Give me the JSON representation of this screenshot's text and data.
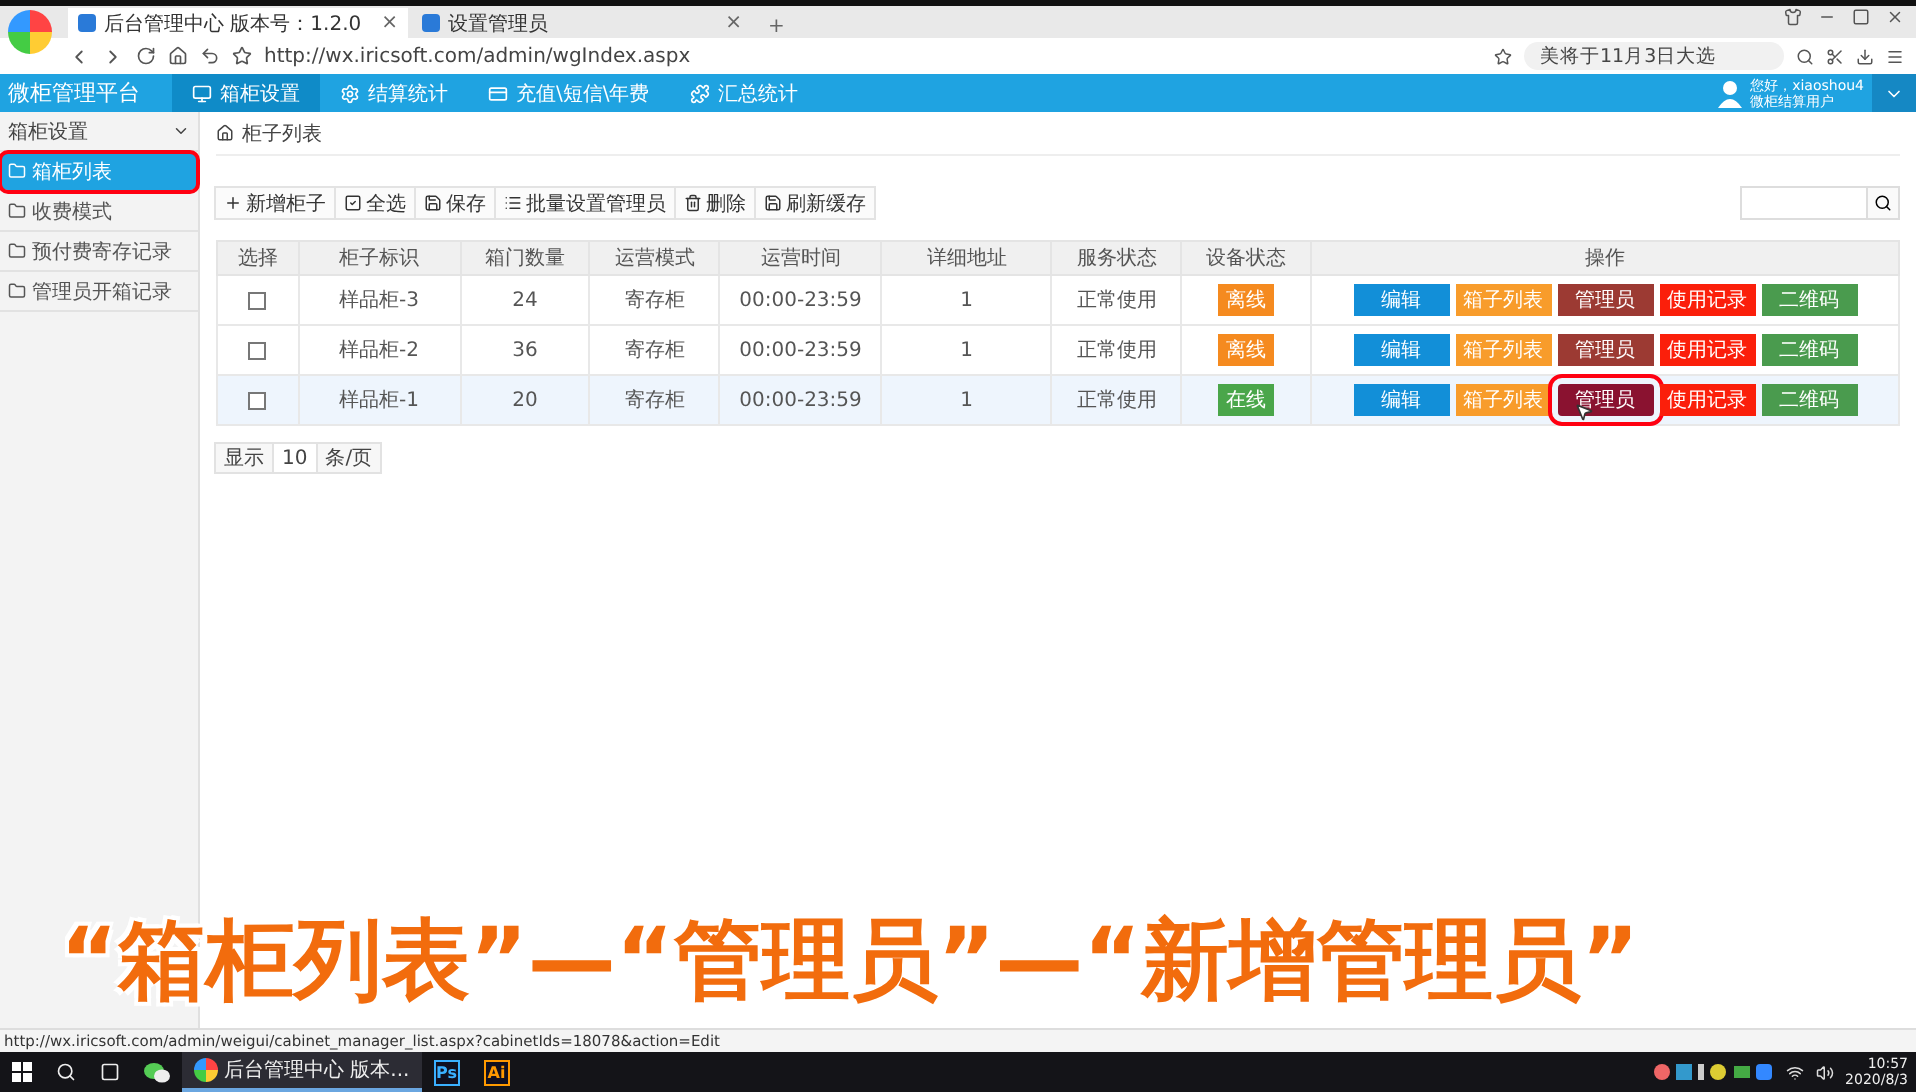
{
  "browser": {
    "tabs": [
      {
        "title": "后台管理中心 版本号：1.2.0",
        "close": "×",
        "selected": true
      },
      {
        "title": "设置管理员",
        "close": "×",
        "selected": false
      }
    ],
    "new_tab": "+",
    "address": "http://wx.iricsoft.com/admin/wgIndex.aspx",
    "search_hint": "美将于11月3日大选"
  },
  "app": {
    "logo": "微柜管理平台",
    "nav": [
      {
        "label": "箱柜设置",
        "selected": true,
        "kind": "monitor"
      },
      {
        "label": "结算统计",
        "selected": false,
        "kind": "gear"
      },
      {
        "label": "充值\\短信\\年费",
        "selected": false,
        "kind": "card"
      },
      {
        "label": "汇总统计",
        "selected": false,
        "kind": "puzzle"
      }
    ],
    "user": {
      "greeting": "您好，xiaoshou4",
      "role": "微柜结算用户"
    }
  },
  "sidebar": {
    "title": "箱柜设置",
    "items": [
      {
        "label": "箱柜列表",
        "selected": true,
        "highlighted": true
      },
      {
        "label": "收费模式",
        "selected": false,
        "highlighted": false
      },
      {
        "label": "预付费寄存记录",
        "selected": false,
        "highlighted": false
      },
      {
        "label": "管理员开箱记录",
        "selected": false,
        "highlighted": false
      }
    ]
  },
  "breadcrumb": "柜子列表",
  "toolbar": [
    {
      "label": "新增柜子",
      "kind": "add"
    },
    {
      "label": "全选",
      "kind": "check"
    },
    {
      "label": "保存",
      "kind": "save"
    },
    {
      "label": "批量设置管理员",
      "kind": "list"
    },
    {
      "label": "删除",
      "kind": "delete"
    },
    {
      "label": "刷新缓存",
      "kind": "save"
    }
  ],
  "table": {
    "columns": [
      "选择",
      "柜子标识",
      "箱门数量",
      "运营模式",
      "运营时间",
      "详细地址",
      "服务状态",
      "设备状态",
      "操作"
    ],
    "rows": [
      {
        "checked": false,
        "hovered": false,
        "name": "样品柜-3",
        "doors": "24",
        "mode": "寄存柜",
        "hours": "00:00-23:59",
        "address": "1",
        "service": "正常使用",
        "device": {
          "label": "离线",
          "online": false
        },
        "actions": [
          {
            "label": "编辑",
            "kind": "edit",
            "hovered": false,
            "highlighted": false
          },
          {
            "label": "箱子列表",
            "kind": "list",
            "hovered": false,
            "highlighted": false
          },
          {
            "label": "管理员",
            "kind": "admin",
            "hovered": false,
            "highlighted": false
          },
          {
            "label": "使用记录",
            "kind": "log",
            "hovered": false,
            "highlighted": false
          },
          {
            "label": "二维码",
            "kind": "qr",
            "hovered": false,
            "highlighted": false
          }
        ]
      },
      {
        "checked": false,
        "hovered": false,
        "name": "样品柜-2",
        "doors": "36",
        "mode": "寄存柜",
        "hours": "00:00-23:59",
        "address": "1",
        "service": "正常使用",
        "device": {
          "label": "离线",
          "online": false
        },
        "actions": [
          {
            "label": "编辑",
            "kind": "edit",
            "hovered": false,
            "highlighted": false
          },
          {
            "label": "箱子列表",
            "kind": "list",
            "hovered": false,
            "highlighted": false
          },
          {
            "label": "管理员",
            "kind": "admin",
            "hovered": false,
            "highlighted": false
          },
          {
            "label": "使用记录",
            "kind": "log",
            "hovered": false,
            "highlighted": false
          },
          {
            "label": "二维码",
            "kind": "qr",
            "hovered": false,
            "highlighted": false
          }
        ]
      },
      {
        "checked": false,
        "hovered": true,
        "name": "样品柜-1",
        "doors": "20",
        "mode": "寄存柜",
        "hours": "00:00-23:59",
        "address": "1",
        "service": "正常使用",
        "device": {
          "label": "在线",
          "online": true
        },
        "actions": [
          {
            "label": "编辑",
            "kind": "edit",
            "hovered": false,
            "highlighted": false
          },
          {
            "label": "箱子列表",
            "kind": "list",
            "hovered": false,
            "highlighted": false
          },
          {
            "label": "管理员",
            "kind": "admin",
            "hovered": true,
            "highlighted": true
          },
          {
            "label": "使用记录",
            "kind": "log",
            "hovered": false,
            "highlighted": false
          },
          {
            "label": "二维码",
            "kind": "qr",
            "hovered": false,
            "highlighted": false
          }
        ]
      }
    ]
  },
  "pager": {
    "prefix": "显示",
    "size": "10",
    "suffix": "条/页"
  },
  "caption": "“箱柜列表”—“管理员”—“新增管理员”",
  "status_url": "http://wx.iricsoft.com/admin/weigui/cabinet_manager_list.aspx?cabinetIds=18078&action=Edit",
  "taskbar": {
    "items": [
      {
        "label": "后台管理中心 版本...",
        "kind": "browser",
        "selected": true
      },
      {
        "label": "Ps",
        "kind": "ps",
        "selected": false
      },
      {
        "label": "Ai",
        "kind": "ai",
        "selected": false
      }
    ],
    "time": "10:57",
    "date": "2020/8/3"
  }
}
